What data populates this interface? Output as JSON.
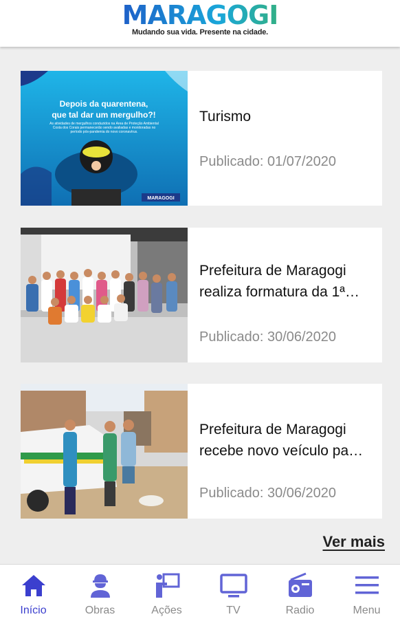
{
  "header": {
    "logo_text": "MARAGOGI",
    "tagline": "Mudando sua vida. Presente na cidade."
  },
  "thumb1": {
    "headline_line1": "Depois da quarentena,",
    "headline_line2": "que tal dar um mergulho?!",
    "body": "As atividades de mergulhos conduzidos na Área de Proteção Ambiental Costa dos Corais permanecerão sendo avaliadas e monitoradas no período pós-pandemia do novo coronavírus.",
    "brand": "MARAGOGI"
  },
  "news": [
    {
      "title": "Turismo",
      "date": "Publicado: 01/07/2020"
    },
    {
      "title": "Prefeitura de Maragogi\nrealiza formatura da 1ª…",
      "date": "Publicado: 30/06/2020"
    },
    {
      "title": "Prefeitura de Maragogi\nrecebe novo veículo pa…",
      "date": "Publicado: 30/06/2020"
    }
  ],
  "more_label": "Ver mais",
  "nav": [
    {
      "label": "Início",
      "icon": "home-icon",
      "active": true
    },
    {
      "label": "Obras",
      "icon": "worker-icon",
      "active": false
    },
    {
      "label": "Ações",
      "icon": "presentation-icon",
      "active": false
    },
    {
      "label": "TV",
      "icon": "tv-icon",
      "active": false
    },
    {
      "label": "Radio",
      "icon": "radio-icon",
      "active": false
    },
    {
      "label": "Menu",
      "icon": "hamburger-menu-icon",
      "active": false
    }
  ],
  "colors": {
    "accent": "#3b3fce",
    "inactive": "#8a8a8a",
    "background": "#eeeeee"
  }
}
